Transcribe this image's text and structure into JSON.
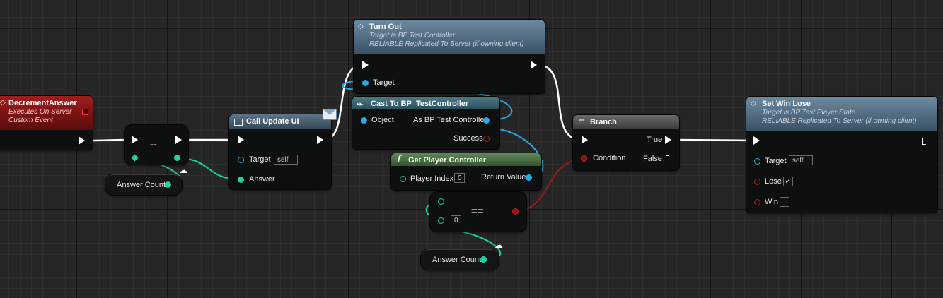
{
  "nodes": {
    "decrement_answer": {
      "title": "DecrementAnswer",
      "subtitle_1": "Executes On Server",
      "subtitle_2": "Custom Event",
      "icon": "diamond-event-icon",
      "color": "#8a1a1a"
    },
    "decrement_op": {
      "operator": "--"
    },
    "answer_count_1": {
      "label": "Answer Count"
    },
    "call_update_ui": {
      "title": "Call Update UI",
      "icon": "function-icon",
      "target_label": "Target",
      "target_value": "self",
      "answer_label": "Answer"
    },
    "turn_out": {
      "title": "Turn Out",
      "subtitle_1": "Target is BP Test Controller",
      "subtitle_2": "RELIABLE Replicated To Server (if owning client)",
      "target_label": "Target",
      "color": "#58738a"
    },
    "cast_to": {
      "title": "Cast To BP_TestController",
      "object_label": "Object",
      "as_label": "As BP Test Controller",
      "success_label": "Success"
    },
    "get_player_controller": {
      "title": "Get Player Controller",
      "icon": "f",
      "player_index_label": "Player Index",
      "player_index_value": "0",
      "return_label": "Return Value"
    },
    "equal_op": {
      "operator": "==",
      "value": "0"
    },
    "answer_count_2": {
      "label": "Answer Count"
    },
    "branch": {
      "title": "Branch",
      "condition_label": "Condition",
      "true_label": "True",
      "false_label": "False"
    },
    "set_win_lose": {
      "title": "Set Win Lose",
      "subtitle_1": "Target is BP Test Player State",
      "subtitle_2": "RELIABLE Replicated To Server (if owning client)",
      "target_label": "Target",
      "target_value": "self",
      "lose_label": "Lose",
      "lose_checked": "✓",
      "win_label": "Win",
      "win_checked": ""
    }
  },
  "colors": {
    "exec_wire": "#ffffff",
    "object_wire": "#2aa9e8",
    "int_wire": "#1cd3a0",
    "bool_wire": "#9a1a1a"
  }
}
